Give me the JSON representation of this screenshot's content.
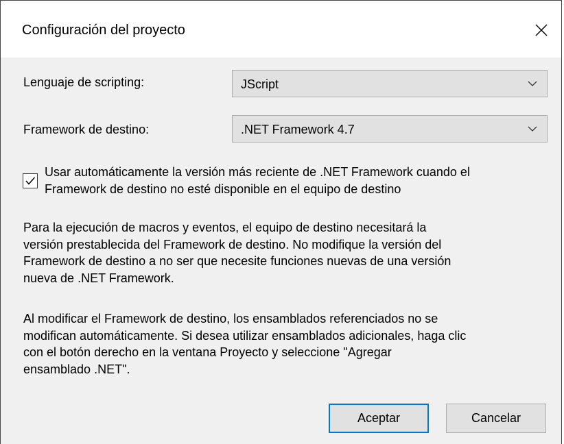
{
  "window": {
    "title": "Configuración del proyecto",
    "close_icon": "close-icon"
  },
  "form": {
    "scripting_language": {
      "label": "Lenguaje de scripting:",
      "value": "JScript"
    },
    "target_framework": {
      "label": "Framework de destino:",
      "value": ".NET Framework 4.7"
    },
    "auto_latest": {
      "checked": true,
      "label_line1": "Usar automáticamente la versión más reciente de .NET Framework cuando el",
      "label_line2": "Framework de destino no esté disponible en el equipo de destino"
    }
  },
  "info": {
    "paragraph1": [
      "Para la ejecución de macros y eventos, el equipo de destino necesitará la",
      "versión prestablecida del Framework de destino. No modifique la versión del",
      "Framework de destino a no ser que necesite funciones nuevas de una versión",
      "nueva de .NET Framework."
    ],
    "paragraph2": [
      "Al modificar el Framework de destino, los ensamblados referenciados no se",
      "modifican automáticamente. Si desea utilizar ensamblados adicionales, haga clic",
      "con el botón derecho en la ventana Proyecto y seleccione \"Agregar",
      "ensamblado .NET\"."
    ]
  },
  "buttons": {
    "ok": "Aceptar",
    "cancel": "Cancelar"
  },
  "colors": {
    "dialog_bg": "#f0f0f0",
    "titlebar_bg": "#ffffff",
    "control_bg": "#e1e1e1",
    "default_button_border": "#0078d7"
  }
}
